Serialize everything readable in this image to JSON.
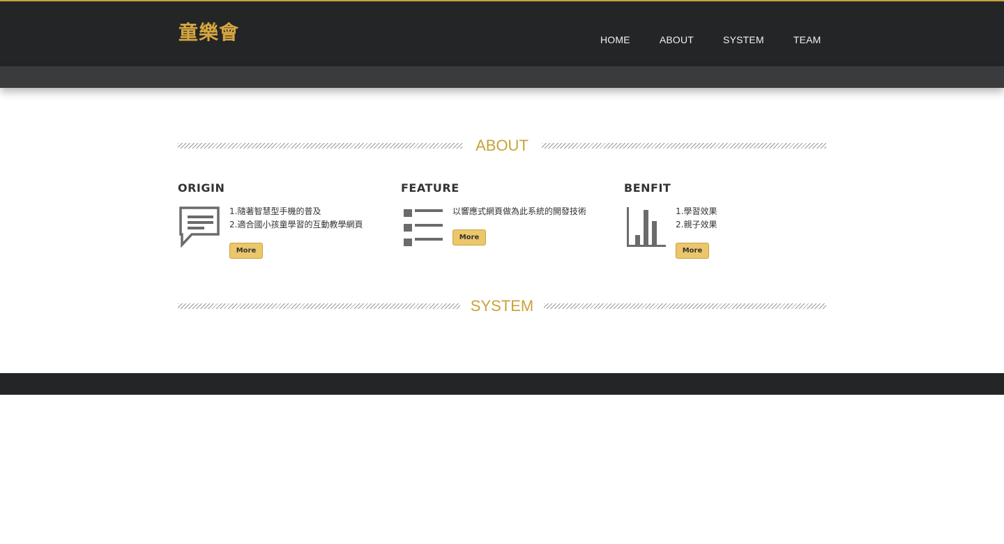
{
  "header": {
    "logo": "童樂會",
    "nav": [
      "HOME",
      "ABOUT",
      "SYSTEM",
      "TEAM"
    ]
  },
  "sections": {
    "about": "ABOUT",
    "system": "SYSTEM"
  },
  "columns": [
    {
      "title": "ORIGIN",
      "icon": "speech-bubble-icon",
      "lines": [
        "1.隨著智慧型手機的普及",
        "2.適合國小孩童學習的互動教學網頁"
      ],
      "button": "More"
    },
    {
      "title": "FEATURE",
      "icon": "list-icon",
      "lines": [
        "以響應式網頁做為此系統的開發技術"
      ],
      "button": "More"
    },
    {
      "title": "BENFIT",
      "icon": "bar-chart-icon",
      "lines": [
        "1.學習效果",
        "2.親子效果"
      ],
      "button": "More"
    }
  ],
  "colors": {
    "accent": "#c9a23a",
    "header_bg": "#242527",
    "subbar_bg": "#3a3b3d",
    "button_bg": "#ecc66b"
  }
}
